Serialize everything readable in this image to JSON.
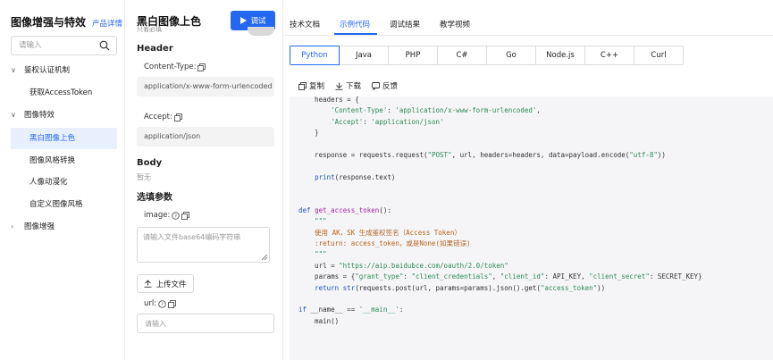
{
  "sidebar": {
    "title": "图像增强与特效",
    "link": "产品详情",
    "search_placeholder": "请输入",
    "items": [
      {
        "label": "鉴权认证机制",
        "kind": "group",
        "expanded": true
      },
      {
        "label": "获取AccessToken",
        "kind": "sub"
      },
      {
        "label": "图像特效",
        "kind": "group",
        "expanded": true
      },
      {
        "label": "黑白图像上色",
        "kind": "sub",
        "active": true
      },
      {
        "label": "图像风格转换",
        "kind": "sub"
      },
      {
        "label": "人像动漫化",
        "kind": "sub"
      },
      {
        "label": "自定义图像风格",
        "kind": "sub"
      },
      {
        "label": "图像增强",
        "kind": "group",
        "expanded": false
      }
    ]
  },
  "panel": {
    "title": "黑白图像上色",
    "debug_button": "调试",
    "clipped_label": "只看必填",
    "header_title": "Header",
    "content_type_label": "Content-Type:",
    "content_type_value": "application/x-www-form-urlencoded",
    "accept_label": "Accept:",
    "accept_value": "application/json",
    "body_title": "Body",
    "body_none": "暂无",
    "params_title": "选填参数",
    "image_label": "image:",
    "image_placeholder": "请输入文件base64编码字符串",
    "upload_button": "上传文件",
    "url_label": "url:",
    "url_placeholder": "请输入"
  },
  "tabs": [
    {
      "label": "技术文档"
    },
    {
      "label": "示例代码",
      "active": true
    },
    {
      "label": "调试结果"
    },
    {
      "label": "教学视频"
    }
  ],
  "languages": [
    "Python",
    "Java",
    "PHP",
    "C#",
    "Go",
    "Node.js",
    "C++",
    "Curl"
  ],
  "selected_language": "Python",
  "code_toolbar": {
    "copy": "复制",
    "download": "下载",
    "feedback": "反馈"
  },
  "code_lines": [
    [
      {
        "t": "    headers = {"
      }
    ],
    [
      {
        "t": "        "
      },
      {
        "t": "'Content-Type'",
        "c": "str"
      },
      {
        "t": ": "
      },
      {
        "t": "'application/x-www-form-urlencoded'",
        "c": "str"
      },
      {
        "t": ","
      }
    ],
    [
      {
        "t": "        "
      },
      {
        "t": "'Accept'",
        "c": "str"
      },
      {
        "t": ": "
      },
      {
        "t": "'application/json'",
        "c": "str"
      }
    ],
    [
      {
        "t": "    }"
      }
    ],
    [
      {
        "t": ""
      }
    ],
    [
      {
        "t": "    response = requests.request("
      },
      {
        "t": "\"POST\"",
        "c": "str"
      },
      {
        "t": ", url, headers=headers, data=payload.encode("
      },
      {
        "t": "\"utf-8\"",
        "c": "str"
      },
      {
        "t": "))"
      }
    ],
    [
      {
        "t": ""
      }
    ],
    [
      {
        "t": "    "
      },
      {
        "t": "print",
        "c": "kw"
      },
      {
        "t": "(response.text)"
      }
    ],
    [
      {
        "t": ""
      }
    ],
    [
      {
        "t": ""
      }
    ],
    [
      {
        "t": "def",
        "c": "kw"
      },
      {
        "t": " "
      },
      {
        "t": "get_access_token",
        "c": "fn"
      },
      {
        "t": "():"
      }
    ],
    [
      {
        "t": "    "
      },
      {
        "t": "\"\"\"",
        "c": "str"
      }
    ],
    [
      {
        "t": "    使用 AK，SK 生成鉴权签名（Access Token）",
        "c": "cm"
      }
    ],
    [
      {
        "t": "    :return: access_token，或是None(如果错误)",
        "c": "cm"
      }
    ],
    [
      {
        "t": "    "
      },
      {
        "t": "\"\"\"",
        "c": "str"
      }
    ],
    [
      {
        "t": "    url = "
      },
      {
        "t": "\"https://aip.baidubce.com/oauth/2.0/token\"",
        "c": "str"
      }
    ],
    [
      {
        "t": "    params = {"
      },
      {
        "t": "\"grant_type\"",
        "c": "str"
      },
      {
        "t": ": "
      },
      {
        "t": "\"client_credentials\"",
        "c": "str"
      },
      {
        "t": ", "
      },
      {
        "t": "\"client_id\"",
        "c": "str"
      },
      {
        "t": ": API_KEY, "
      },
      {
        "t": "\"client_secret\"",
        "c": "str"
      },
      {
        "t": ": SECRET_KEY}"
      }
    ],
    [
      {
        "t": "    "
      },
      {
        "t": "return",
        "c": "kw"
      },
      {
        "t": " "
      },
      {
        "t": "str",
        "c": "kw"
      },
      {
        "t": "(requests.post(url, params=params).json().get("
      },
      {
        "t": "\"access_token\"",
        "c": "str"
      },
      {
        "t": "))"
      }
    ],
    [
      {
        "t": ""
      }
    ],
    [
      {
        "t": "if",
        "c": "kw"
      },
      {
        "t": " __name__ == "
      },
      {
        "t": "'__main__'",
        "c": "str"
      },
      {
        "t": ":"
      }
    ],
    [
      {
        "t": "    main()"
      }
    ]
  ],
  "colors": {
    "accent": "#2468f2",
    "active_bg": "#e8f0fe",
    "code_bg": "#f5f5f7"
  }
}
